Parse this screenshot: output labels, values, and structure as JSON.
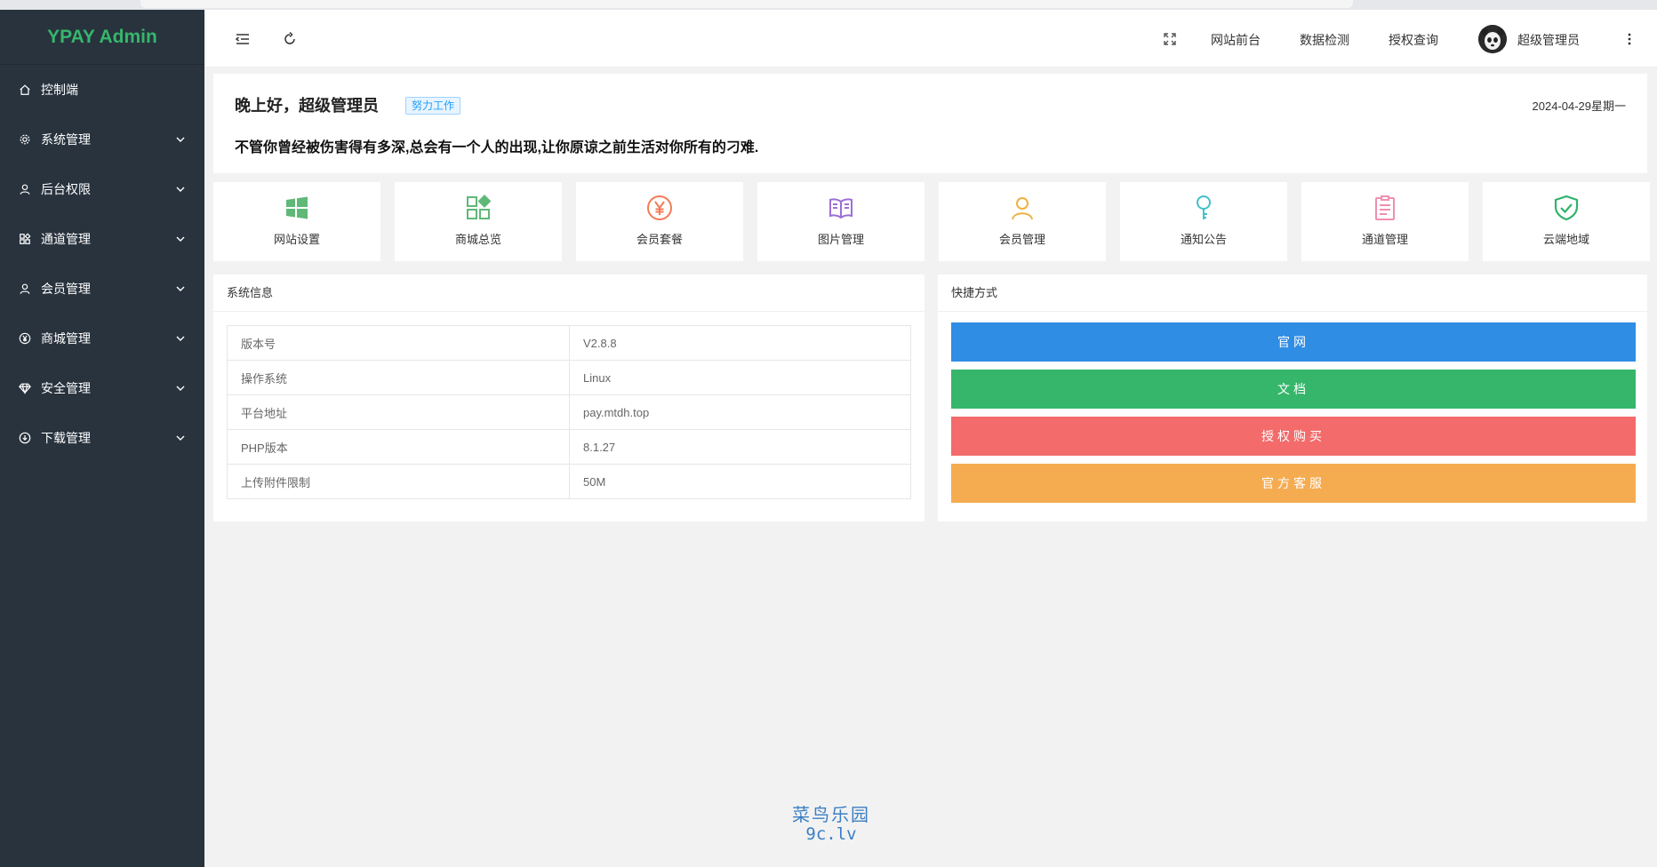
{
  "brand": {
    "title": "YPAY Admin"
  },
  "sidebar": {
    "items": [
      {
        "label": "控制端",
        "icon": "home-icon"
      },
      {
        "label": "系统管理",
        "icon": "gear-icon"
      },
      {
        "label": "后台权限",
        "icon": "user-icon"
      },
      {
        "label": "通道管理",
        "icon": "apps-icon"
      },
      {
        "label": "会员管理",
        "icon": "user-icon"
      },
      {
        "label": "商城管理",
        "icon": "yen-circle-icon"
      },
      {
        "label": "安全管理",
        "icon": "diamond-icon"
      },
      {
        "label": "下载管理",
        "icon": "download-circle-icon"
      }
    ]
  },
  "header": {
    "nav": {
      "frontend": "网站前台",
      "data_check": "数据检测",
      "license_query": "授权查询",
      "user_name": "超级管理员"
    }
  },
  "welcome": {
    "greeting": "晚上好，超级管理员",
    "tag": "努力工作",
    "date": "2024-04-29星期一",
    "quote": "不管你曾经被伤害得有多深,总会有一个人的出现,让你原谅之前生活对你所有的刁难."
  },
  "tiles": [
    {
      "label": "网站设置",
      "icon": "windows-icon",
      "color": "#5fb878"
    },
    {
      "label": "商城总览",
      "icon": "apps-icon",
      "color": "#5fb878"
    },
    {
      "label": "会员套餐",
      "icon": "yen-circle-icon",
      "color": "#f37b58"
    },
    {
      "label": "图片管理",
      "icon": "book-icon",
      "color": "#9d6fd5"
    },
    {
      "label": "会员管理",
      "icon": "user-icon",
      "color": "#f0b040"
    },
    {
      "label": "通知公告",
      "icon": "key-icon",
      "color": "#3fc1c9"
    },
    {
      "label": "通道管理",
      "icon": "clipboard-icon",
      "color": "#f08fb0"
    },
    {
      "label": "云端地域",
      "icon": "shield-check-icon",
      "color": "#2fb36b"
    }
  ],
  "system_info": {
    "title": "系统信息",
    "rows": [
      {
        "key": "版本号",
        "value": "V2.8.8"
      },
      {
        "key": "操作系统",
        "value": "Linux"
      },
      {
        "key": "平台地址",
        "value": "pay.mtdh.top"
      },
      {
        "key": "PHP版本",
        "value": "8.1.27"
      },
      {
        "key": "上传附件限制",
        "value": "50M"
      }
    ]
  },
  "shortcuts": {
    "title": "快捷方式",
    "buttons": [
      {
        "label": "官网",
        "color": "#2f8de4"
      },
      {
        "label": "文档",
        "color": "#36b66b"
      },
      {
        "label": "授权购买",
        "color": "#f36b6b"
      },
      {
        "label": "官方客服",
        "color": "#f5ac51"
      }
    ]
  },
  "watermark": {
    "line1": "菜鸟乐园",
    "line2": "9c.lv"
  }
}
